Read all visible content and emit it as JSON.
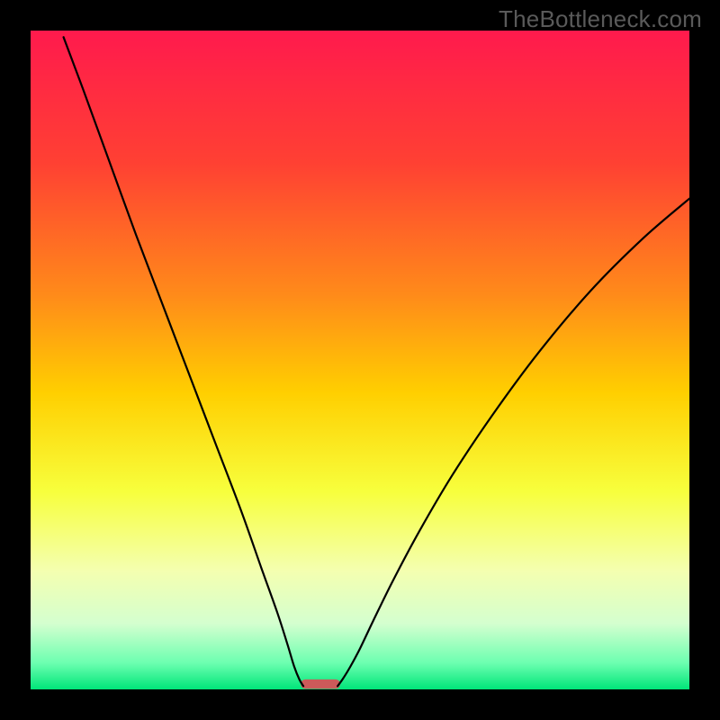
{
  "watermark": "TheBottleneck.com",
  "chart_data": {
    "type": "line",
    "title": "",
    "xlabel": "",
    "ylabel": "",
    "xlim": [
      0,
      100
    ],
    "ylim": [
      0,
      100
    ],
    "grid": false,
    "legend": false,
    "background_gradient": {
      "stops": [
        {
          "pos": 0.0,
          "color": "#ff1a4d"
        },
        {
          "pos": 0.2,
          "color": "#ff4033"
        },
        {
          "pos": 0.4,
          "color": "#ff8a1a"
        },
        {
          "pos": 0.55,
          "color": "#ffcf00"
        },
        {
          "pos": 0.7,
          "color": "#f7ff3d"
        },
        {
          "pos": 0.82,
          "color": "#f4ffb0"
        },
        {
          "pos": 0.9,
          "color": "#d4ffcf"
        },
        {
          "pos": 0.96,
          "color": "#6cffb0"
        },
        {
          "pos": 1.0,
          "color": "#00e579"
        }
      ]
    },
    "series": [
      {
        "name": "left-curve",
        "color": "#000000",
        "width": 2.2,
        "x": [
          5.0,
          8.0,
          12.0,
          16.0,
          20.0,
          24.0,
          28.0,
          32.0,
          35.0,
          37.5,
          39.0,
          40.0,
          40.8,
          41.4
        ],
        "y": [
          99.0,
          91.0,
          80.0,
          69.0,
          58.5,
          48.0,
          37.5,
          27.0,
          18.5,
          11.5,
          6.8,
          3.5,
          1.5,
          0.5
        ]
      },
      {
        "name": "right-curve",
        "color": "#000000",
        "width": 2.2,
        "x": [
          46.6,
          47.4,
          48.5,
          50.0,
          52.0,
          55.0,
          59.0,
          64.0,
          70.0,
          77.0,
          85.0,
          93.0,
          100.0
        ],
        "y": [
          0.5,
          1.6,
          3.4,
          6.2,
          10.4,
          16.5,
          24.0,
          32.5,
          41.5,
          51.0,
          60.5,
          68.5,
          74.5
        ]
      }
    ],
    "marker": {
      "name": "floor-marker",
      "x_range": [
        41.0,
        47.0
      ],
      "y": 0.0,
      "thickness_pct": 1.6,
      "color": "#cc5a5a"
    }
  }
}
